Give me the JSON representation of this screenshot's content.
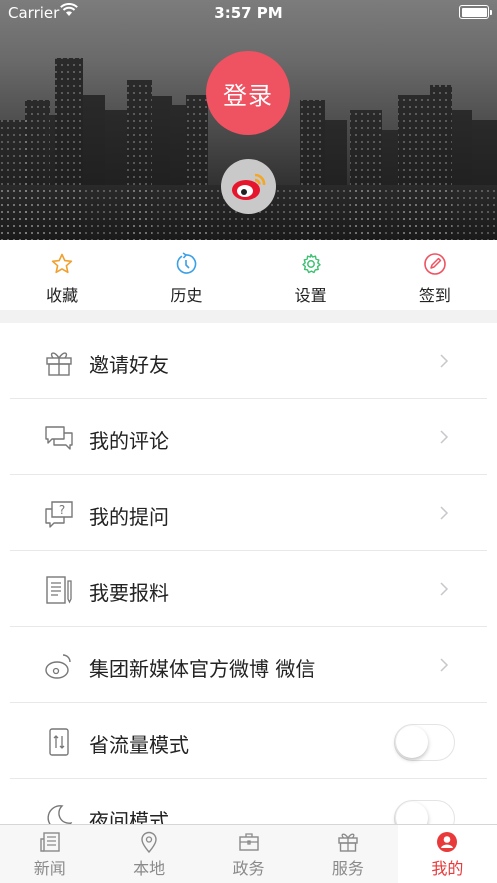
{
  "status_bar": {
    "carrier": "Carrier",
    "time": "3:57 PM"
  },
  "header": {
    "login_label": "登录",
    "weibo_icon": "weibo-icon"
  },
  "quick_actions": [
    {
      "label": "收藏",
      "icon": "star-icon",
      "color": "#f0a030"
    },
    {
      "label": "历史",
      "icon": "history-icon",
      "color": "#3aa0e8"
    },
    {
      "label": "设置",
      "icon": "gear-icon",
      "color": "#3cc070"
    },
    {
      "label": "签到",
      "icon": "pen-icon",
      "color": "#ef5260"
    }
  ],
  "menu": [
    {
      "label": "邀请好友",
      "icon": "gift-icon"
    },
    {
      "label": "我的评论",
      "icon": "comments-icon"
    },
    {
      "label": "我的提问",
      "icon": "question-icon"
    },
    {
      "label": "我要报料",
      "icon": "report-icon"
    },
    {
      "label": "集团新媒体官方微博 微信",
      "icon": "weibo-outline-icon"
    },
    {
      "label": "省流量模式",
      "icon": "data-saver-icon",
      "toggle": false
    },
    {
      "label": "夜间模式",
      "icon": "moon-icon",
      "toggle": false
    }
  ],
  "tab_bar": [
    {
      "label": "新闻",
      "icon": "news-icon"
    },
    {
      "label": "本地",
      "icon": "location-icon"
    },
    {
      "label": "政务",
      "icon": "briefcase-icon"
    },
    {
      "label": "服务",
      "icon": "gift-tab-icon"
    },
    {
      "label": "我的",
      "icon": "profile-icon",
      "active": true
    }
  ],
  "colors": {
    "accent": "#ef5260",
    "active_tab": "#e83a3a"
  }
}
